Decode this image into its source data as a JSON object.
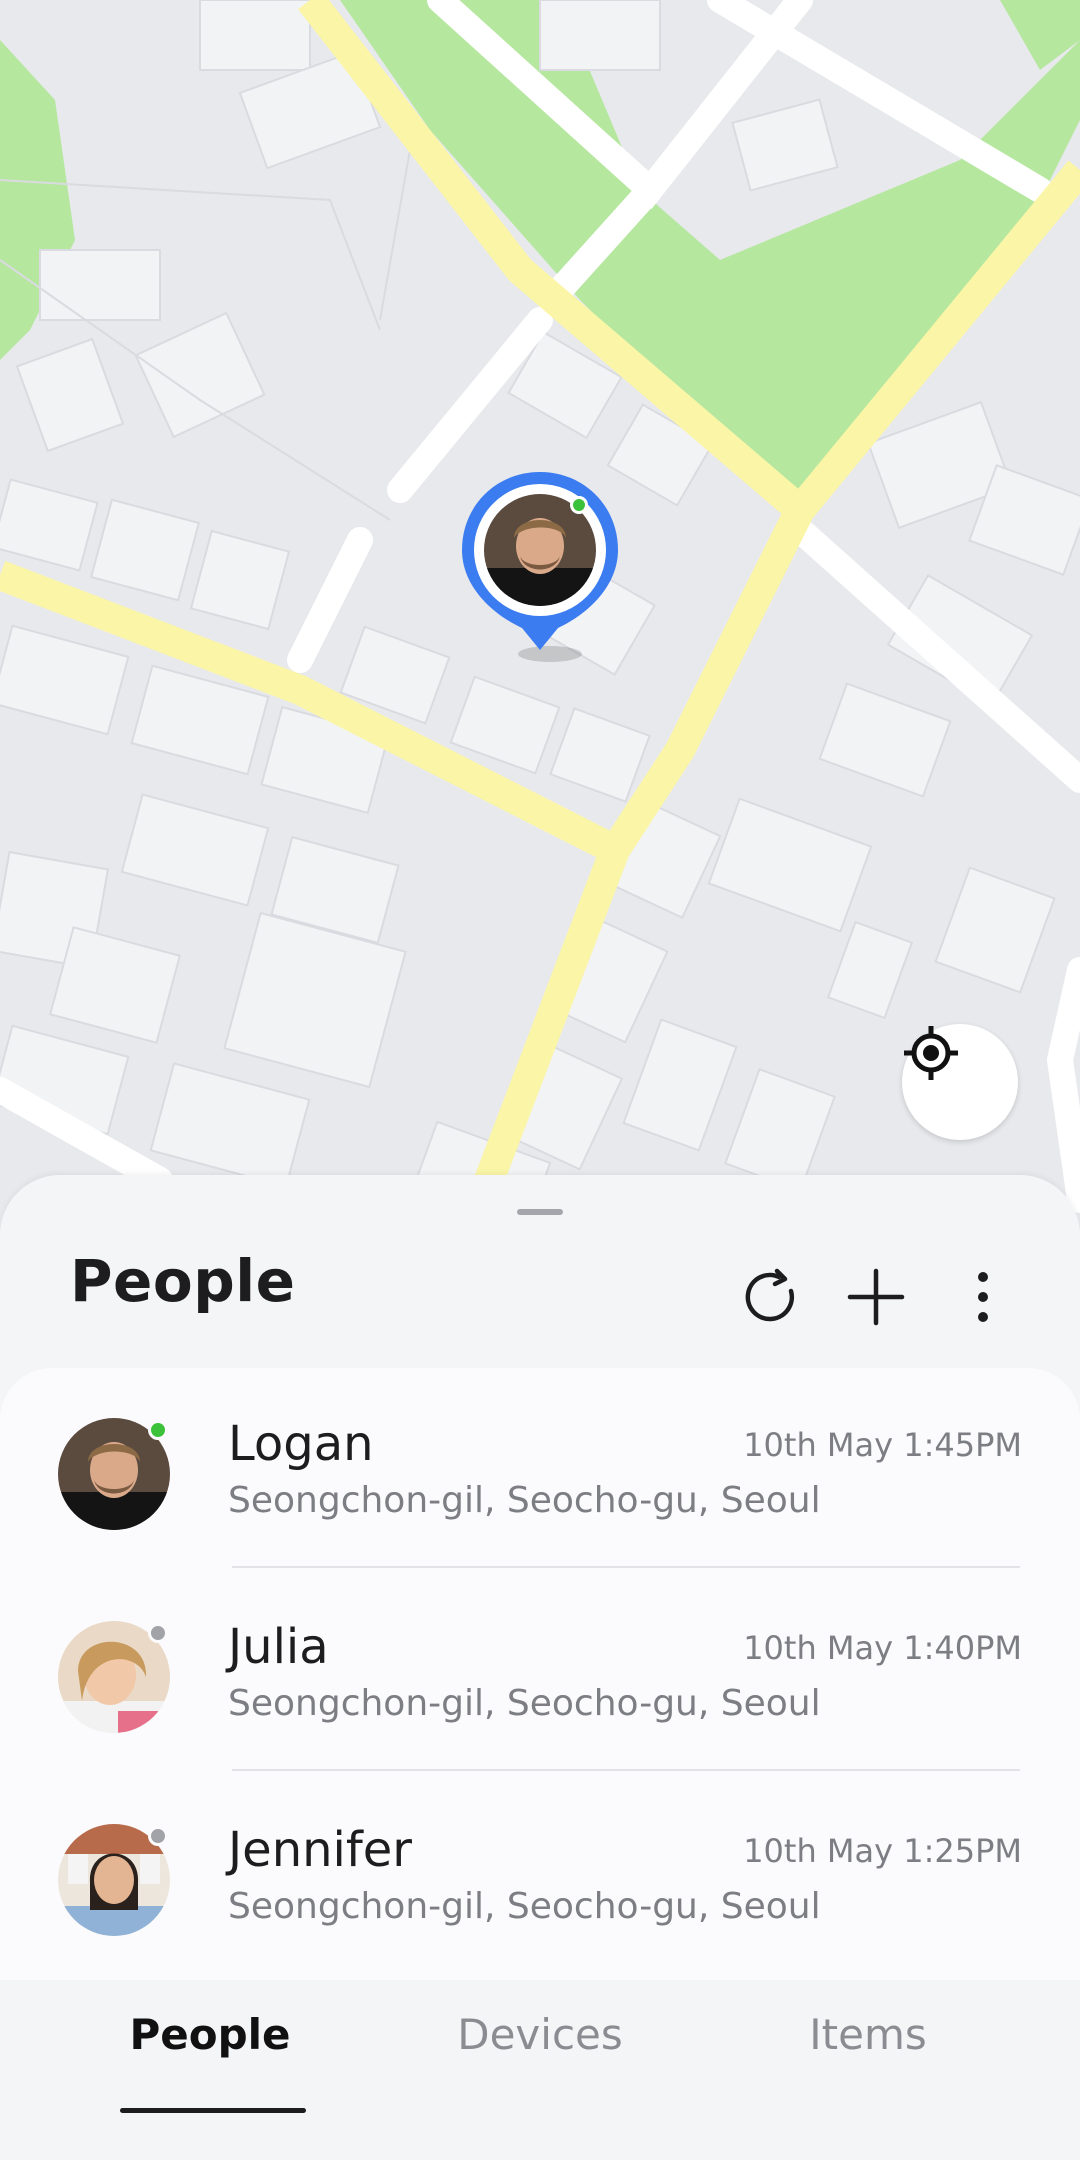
{
  "map": {
    "pin_person": "Logan",
    "pin_status": "online",
    "locate_icon": "my-location-icon",
    "colors": {
      "road_major": "#fbf5a7",
      "road_minor": "#ffffff",
      "park": "#b5e79f",
      "building": "#f2f3f5",
      "ground": "#e8e9ec",
      "pin": "#3b7cf0"
    }
  },
  "sheet": {
    "title": "People",
    "actions": [
      {
        "name": "refresh",
        "icon": "refresh-icon"
      },
      {
        "name": "add",
        "icon": "plus-icon"
      },
      {
        "name": "more",
        "icon": "more-vertical-icon"
      }
    ]
  },
  "people": [
    {
      "name": "Logan",
      "time": "10th May 1:45PM",
      "address": "Seongchon-gil, Seocho-gu, Seoul",
      "status": "online",
      "status_color": "#3cc13b"
    },
    {
      "name": "Julia",
      "time": "10th May 1:40PM",
      "address": "Seongchon-gil, Seocho-gu, Seoul",
      "status": "offline",
      "status_color": "#a1a3a8"
    },
    {
      "name": "Jennifer",
      "time": "10th May 1:25PM",
      "address": "Seongchon-gil, Seocho-gu, Seoul",
      "status": "offline",
      "status_color": "#a1a3a8"
    }
  ],
  "tabs": [
    {
      "label": "People",
      "selected": true
    },
    {
      "label": "Devices",
      "selected": false
    },
    {
      "label": "Items",
      "selected": false
    }
  ]
}
